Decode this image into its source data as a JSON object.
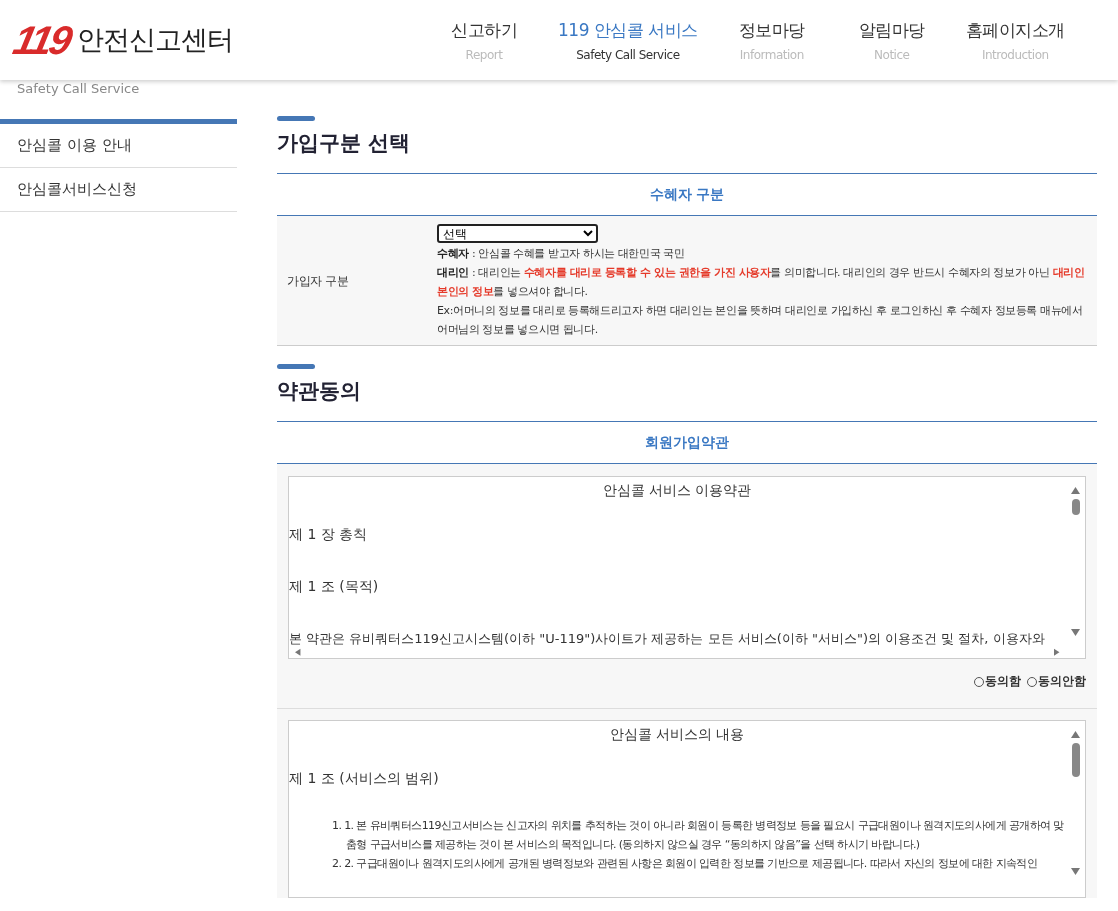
{
  "header": {
    "logo_mark": "119",
    "logo_text": "안전신고센터",
    "nav": [
      {
        "label": "신고하기",
        "sublabel": "Report",
        "selected": false
      },
      {
        "label": "119 안심콜 서비스",
        "sublabel": "Safety Call Service",
        "selected": true
      },
      {
        "label": "정보마당",
        "sublabel": "Information",
        "selected": false
      },
      {
        "label": "알림마당",
        "sublabel": "Notice",
        "selected": false
      },
      {
        "label": "홈페이지소개",
        "sublabel": "Introduction",
        "selected": false
      }
    ]
  },
  "sidebar": {
    "title": "Safety Call Service",
    "items": [
      {
        "label": "안심콜 이용 안내"
      },
      {
        "label": "안심콜서비스신청"
      }
    ]
  },
  "join_section": {
    "title": "가입구분 선택",
    "table_heading": "수혜자 구분",
    "row_label": "가입자 구분",
    "select": {
      "value": "선택"
    },
    "lines": [
      "**수혜자** : 안심콜 수혜를 받고자 하시는 대한민국 국민",
      "**대리인** : 대리인는 **수혜자를 대리로 등록할 수 있는 권한을 가진 사용자**를 의미합니다. 대리인의 경우 반드시 수혜자의 정보가 아닌 **대리인 본인의 정보**를 넣으셔야 합니다.",
      "Ex:어머니의 정보를 대리로 등록해드리고자 하면 대리인는 본인을 뜻하며 대리인로 가입하신 후 로그인하신 후 수혜자 정보등록 매뉴에서 어머님의 정보를 넣으시면 됩니다."
    ]
  },
  "terms_section": {
    "title": "약관동의",
    "table_heading": "회원가입약관",
    "terms_box": {
      "title": "안심콜 서비스 이용약관",
      "paragraphs": [
        "제 1 장 총칙",
        "제 1 조 (목적)",
        "본 약관은 유비쿼터스119신고시스템(이하 \"U-119\")사이트가 제공하는 모든 서비스(이하 \"서비스\")의 이용조건 및 절차, 이용자와"
      ]
    },
    "agree_options": [
      {
        "label": "동의함",
        "selected": false
      },
      {
        "label": "동의안함",
        "selected": false
      }
    ],
    "content_box": {
      "title": "안심콜 서비스의 내용",
      "heading": "제 1 조 (서비스의 범위)",
      "items": [
        "1. 1. 본 유비쿼터스119신고서비스는 신고자의 위치를 추적하는 것이 아니라 회원이 등록한 병력정보 등을 필요시 구급대원이나 원격지도의사에게 공개하여 맞춤형 구급서비스를 제공하는 것이 본 서비스의 목적입니다. (동의하지 않으실 경우 “동의하지 않음”을 선택 하시기 바랍니다.)",
        "2. 2. 구급대원이나 원격지도의사에게 공개된 병력정보와 관련된 사항은 회원이 입력한 정보를 기반으로 제공됩니다. 따라서 자신의 정보에 대한 지속적인"
      ]
    }
  }
}
